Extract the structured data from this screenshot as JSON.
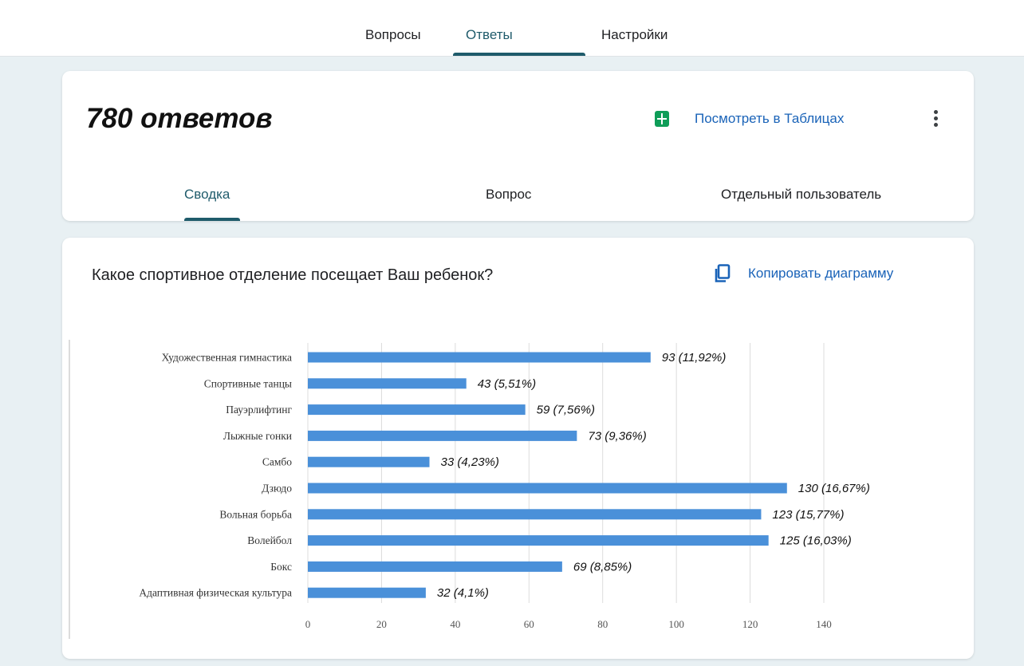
{
  "top_tabs": [
    {
      "label": "Вопросы"
    },
    {
      "label": "Ответы"
    },
    {
      "label": "Настройки"
    }
  ],
  "summary": {
    "responses_title": "780 ответов",
    "sheets_link": "Посмотреть в Таблицах",
    "sheets_icon": "sheets-icon",
    "more_icon": "more-vert-icon"
  },
  "sub_tabs": [
    {
      "label": "Сводка"
    },
    {
      "label": "Вопрос"
    },
    {
      "label": "Отдельный пользователь"
    }
  ],
  "question": {
    "title": "Какое спортивное отделение посещает Ваш ребенок?",
    "copy_label": "Копировать диаграмму",
    "copy_icon": "copy-icon"
  },
  "colors": {
    "accent": "#1f5b6b",
    "link": "#1a63b8",
    "bar": "#4a90d9"
  },
  "chart_data": {
    "type": "bar",
    "orientation": "horizontal",
    "categories": [
      "Художественная гимнастика",
      "Спортивные танцы",
      "Пауэрлифтинг",
      "Лыжные гонки",
      "Самбо",
      "Дзюдо",
      "Вольная борьба",
      "Волейбол",
      "Бокс",
      "Адаптивная физическая культура"
    ],
    "values": [
      93,
      43,
      59,
      73,
      33,
      130,
      123,
      125,
      69,
      32
    ],
    "data_labels": [
      "93 (11,92%)",
      "43 (5,51%)",
      "59 (7,56%)",
      "73 (9,36%)",
      "33 (4,23%)",
      "130 (16,67%)",
      "123 (15,77%)",
      "125 (16,03%)",
      "69 (8,85%)",
      "32 (4,1%)"
    ],
    "xticks": [
      "0",
      "20",
      "40",
      "60",
      "80",
      "100",
      "120",
      "140"
    ],
    "xlim": [
      0,
      140
    ],
    "grid": true
  }
}
